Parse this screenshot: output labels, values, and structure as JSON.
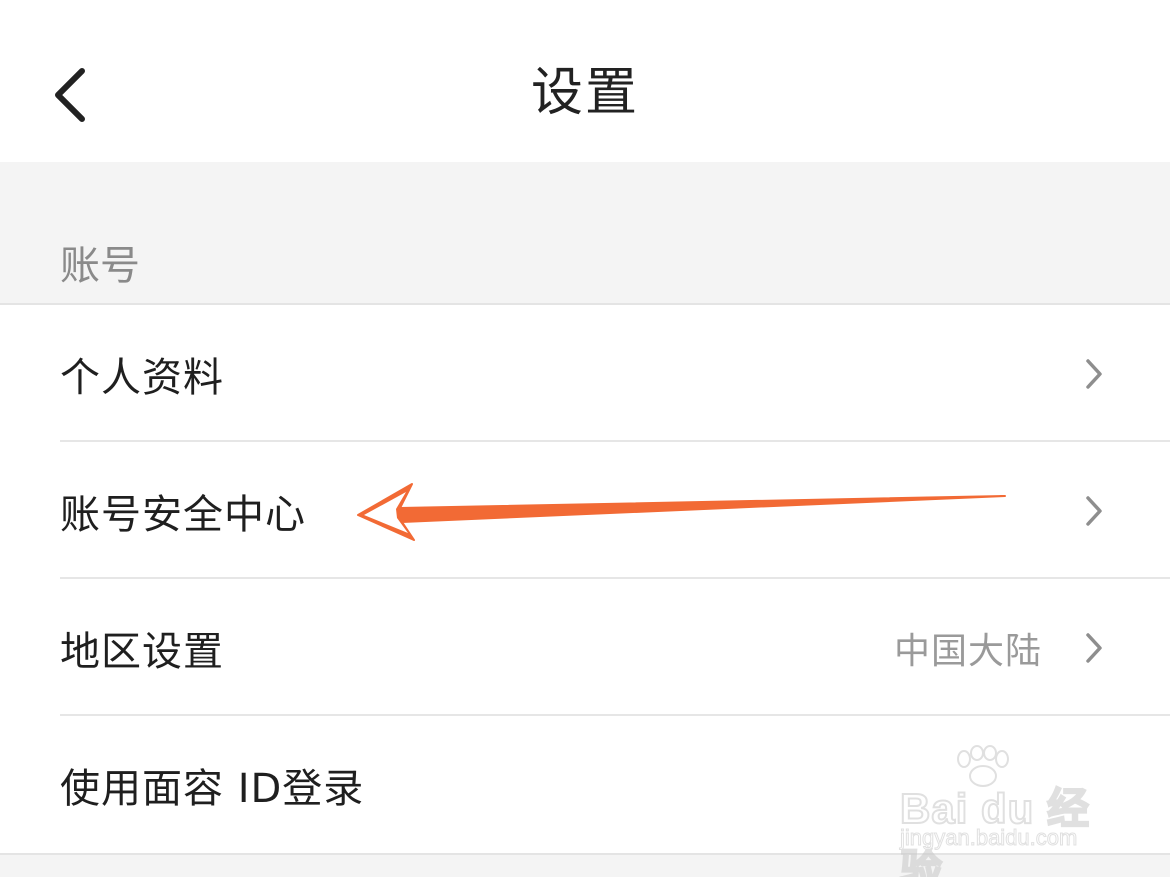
{
  "navbar": {
    "title": "设置",
    "back_icon": "chevron-left-icon"
  },
  "account_section": {
    "label": "账号",
    "items": [
      {
        "label": "个人资料",
        "value": "",
        "icon": "chevron-right-icon"
      },
      {
        "label": "账号安全中心",
        "value": "",
        "icon": "chevron-right-icon"
      },
      {
        "label": "地区设置",
        "value": "中国大陆",
        "icon": "chevron-right-icon"
      },
      {
        "label": "使用面容 ID登录",
        "value": "",
        "icon": ""
      }
    ]
  },
  "annotation": {
    "arrow_color": "#f26a35",
    "target": "账号安全中心"
  },
  "watermark": {
    "brand": "Bai du 经验",
    "site": "jingyan.baidu.com"
  },
  "colors": {
    "background": "#ffffff",
    "section_background": "#f4f4f4",
    "primary_text": "#1f1f1f",
    "secondary_text": "#9a9a9a",
    "accent_arrow": "#f26a35"
  }
}
